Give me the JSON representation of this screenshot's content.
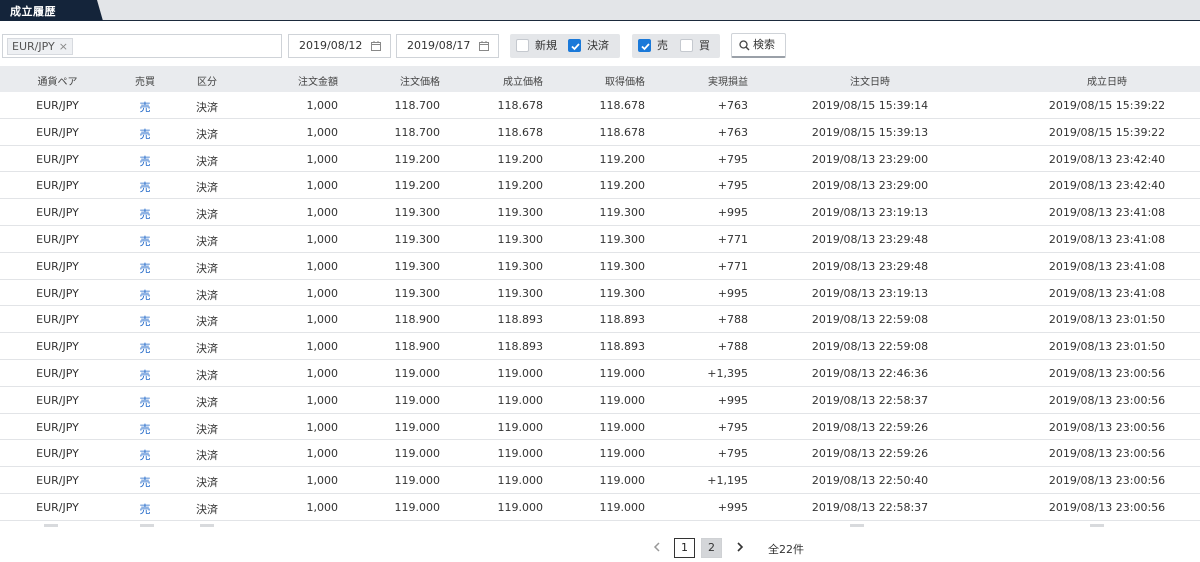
{
  "tab": {
    "title": "成立履歴"
  },
  "filters": {
    "pair_chip": "EUR/JPY",
    "chip_remove": "×",
    "date_from": "2019/08/12",
    "date_to": "2019/08/17",
    "type_group": [
      {
        "label": "新規",
        "checked": false
      },
      {
        "label": "決済",
        "checked": true
      }
    ],
    "side_group": [
      {
        "label": "売",
        "checked": true
      },
      {
        "label": "買",
        "checked": false
      }
    ],
    "search_label": "検索"
  },
  "table": {
    "columns": [
      "通貨ペア",
      "売買",
      "区分",
      "注文金額",
      "注文価格",
      "成立価格",
      "取得価格",
      "実現損益",
      "注文日時",
      "成立日時"
    ],
    "rows": [
      [
        "EUR/JPY",
        "売",
        "決済",
        "1,000",
        "118.700",
        "118.678",
        "118.678",
        "+763",
        "2019/08/15 15:39:14",
        "2019/08/15 15:39:22"
      ],
      [
        "EUR/JPY",
        "売",
        "決済",
        "1,000",
        "118.700",
        "118.678",
        "118.678",
        "+763",
        "2019/08/15 15:39:13",
        "2019/08/15 15:39:22"
      ],
      [
        "EUR/JPY",
        "売",
        "決済",
        "1,000",
        "119.200",
        "119.200",
        "119.200",
        "+795",
        "2019/08/13 23:29:00",
        "2019/08/13 23:42:40"
      ],
      [
        "EUR/JPY",
        "売",
        "決済",
        "1,000",
        "119.200",
        "119.200",
        "119.200",
        "+795",
        "2019/08/13 23:29:00",
        "2019/08/13 23:42:40"
      ],
      [
        "EUR/JPY",
        "売",
        "決済",
        "1,000",
        "119.300",
        "119.300",
        "119.300",
        "+995",
        "2019/08/13 23:19:13",
        "2019/08/13 23:41:08"
      ],
      [
        "EUR/JPY",
        "売",
        "決済",
        "1,000",
        "119.300",
        "119.300",
        "119.300",
        "+771",
        "2019/08/13 23:29:48",
        "2019/08/13 23:41:08"
      ],
      [
        "EUR/JPY",
        "売",
        "決済",
        "1,000",
        "119.300",
        "119.300",
        "119.300",
        "+771",
        "2019/08/13 23:29:48",
        "2019/08/13 23:41:08"
      ],
      [
        "EUR/JPY",
        "売",
        "決済",
        "1,000",
        "119.300",
        "119.300",
        "119.300",
        "+995",
        "2019/08/13 23:19:13",
        "2019/08/13 23:41:08"
      ],
      [
        "EUR/JPY",
        "売",
        "決済",
        "1,000",
        "118.900",
        "118.893",
        "118.893",
        "+788",
        "2019/08/13 22:59:08",
        "2019/08/13 23:01:50"
      ],
      [
        "EUR/JPY",
        "売",
        "決済",
        "1,000",
        "118.900",
        "118.893",
        "118.893",
        "+788",
        "2019/08/13 22:59:08",
        "2019/08/13 23:01:50"
      ],
      [
        "EUR/JPY",
        "売",
        "決済",
        "1,000",
        "119.000",
        "119.000",
        "119.000",
        "+1,395",
        "2019/08/13 22:46:36",
        "2019/08/13 23:00:56"
      ],
      [
        "EUR/JPY",
        "売",
        "決済",
        "1,000",
        "119.000",
        "119.000",
        "119.000",
        "+995",
        "2019/08/13 22:58:37",
        "2019/08/13 23:00:56"
      ],
      [
        "EUR/JPY",
        "売",
        "決済",
        "1,000",
        "119.000",
        "119.000",
        "119.000",
        "+795",
        "2019/08/13 22:59:26",
        "2019/08/13 23:00:56"
      ],
      [
        "EUR/JPY",
        "売",
        "決済",
        "1,000",
        "119.000",
        "119.000",
        "119.000",
        "+795",
        "2019/08/13 22:59:26",
        "2019/08/13 23:00:56"
      ],
      [
        "EUR/JPY",
        "売",
        "決済",
        "1,000",
        "119.000",
        "119.000",
        "119.000",
        "+1,195",
        "2019/08/13 22:50:40",
        "2019/08/13 23:00:56"
      ],
      [
        "EUR/JPY",
        "売",
        "決済",
        "1,000",
        "119.000",
        "119.000",
        "119.000",
        "+995",
        "2019/08/13 22:58:37",
        "2019/08/13 23:00:56"
      ]
    ]
  },
  "pagination": {
    "pages": [
      "1",
      "2"
    ],
    "current": "1",
    "total": "全22件"
  },
  "colors": {
    "tab_active": "#14243a",
    "accent_blue": "#1a79d9",
    "side_text": "#1f67c8",
    "header_bg": "#e9ebee"
  }
}
